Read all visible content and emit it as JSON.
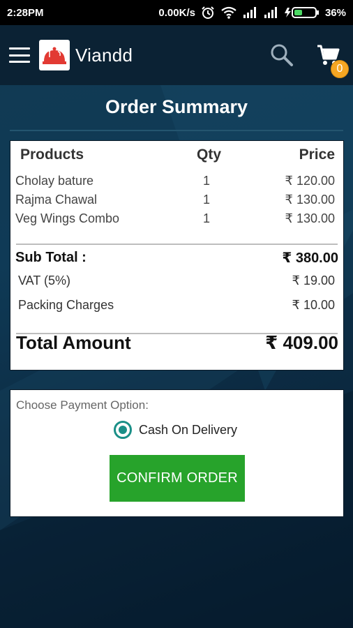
{
  "status": {
    "time": "2:28PM",
    "network_speed": "0.00K/s",
    "battery": "36%"
  },
  "toolbar": {
    "app_name": "Viandd",
    "cart_count": "0"
  },
  "page": {
    "title": "Order Summary"
  },
  "order": {
    "headers": {
      "products": "Products",
      "qty": "Qty",
      "price": "Price"
    },
    "items": [
      {
        "name": "Cholay bature",
        "qty": "1",
        "price": "₹ 120.00"
      },
      {
        "name": "Rajma Chawal",
        "qty": "1",
        "price": "₹ 130.00"
      },
      {
        "name": "Veg Wings Combo",
        "qty": "1",
        "price": "₹ 130.00"
      }
    ],
    "subtotal_label": "Sub Total :",
    "subtotal_value": "₹ 380.00",
    "vat_label": "VAT (5%)",
    "vat_value": "₹ 19.00",
    "packing_label": "Packing Charges",
    "packing_value": "₹ 10.00",
    "total_label": "Total Amount",
    "total_value": "₹ 409.00"
  },
  "payment": {
    "label": "Choose Payment Option:",
    "option": "Cash On Delivery",
    "confirm_label": "CONFIRM ORDER"
  },
  "colors": {
    "toolbar_bg": "#0b2234",
    "accent_green": "#27a32b",
    "radio_teal": "#1a8f87",
    "badge_orange": "#f5a623"
  }
}
